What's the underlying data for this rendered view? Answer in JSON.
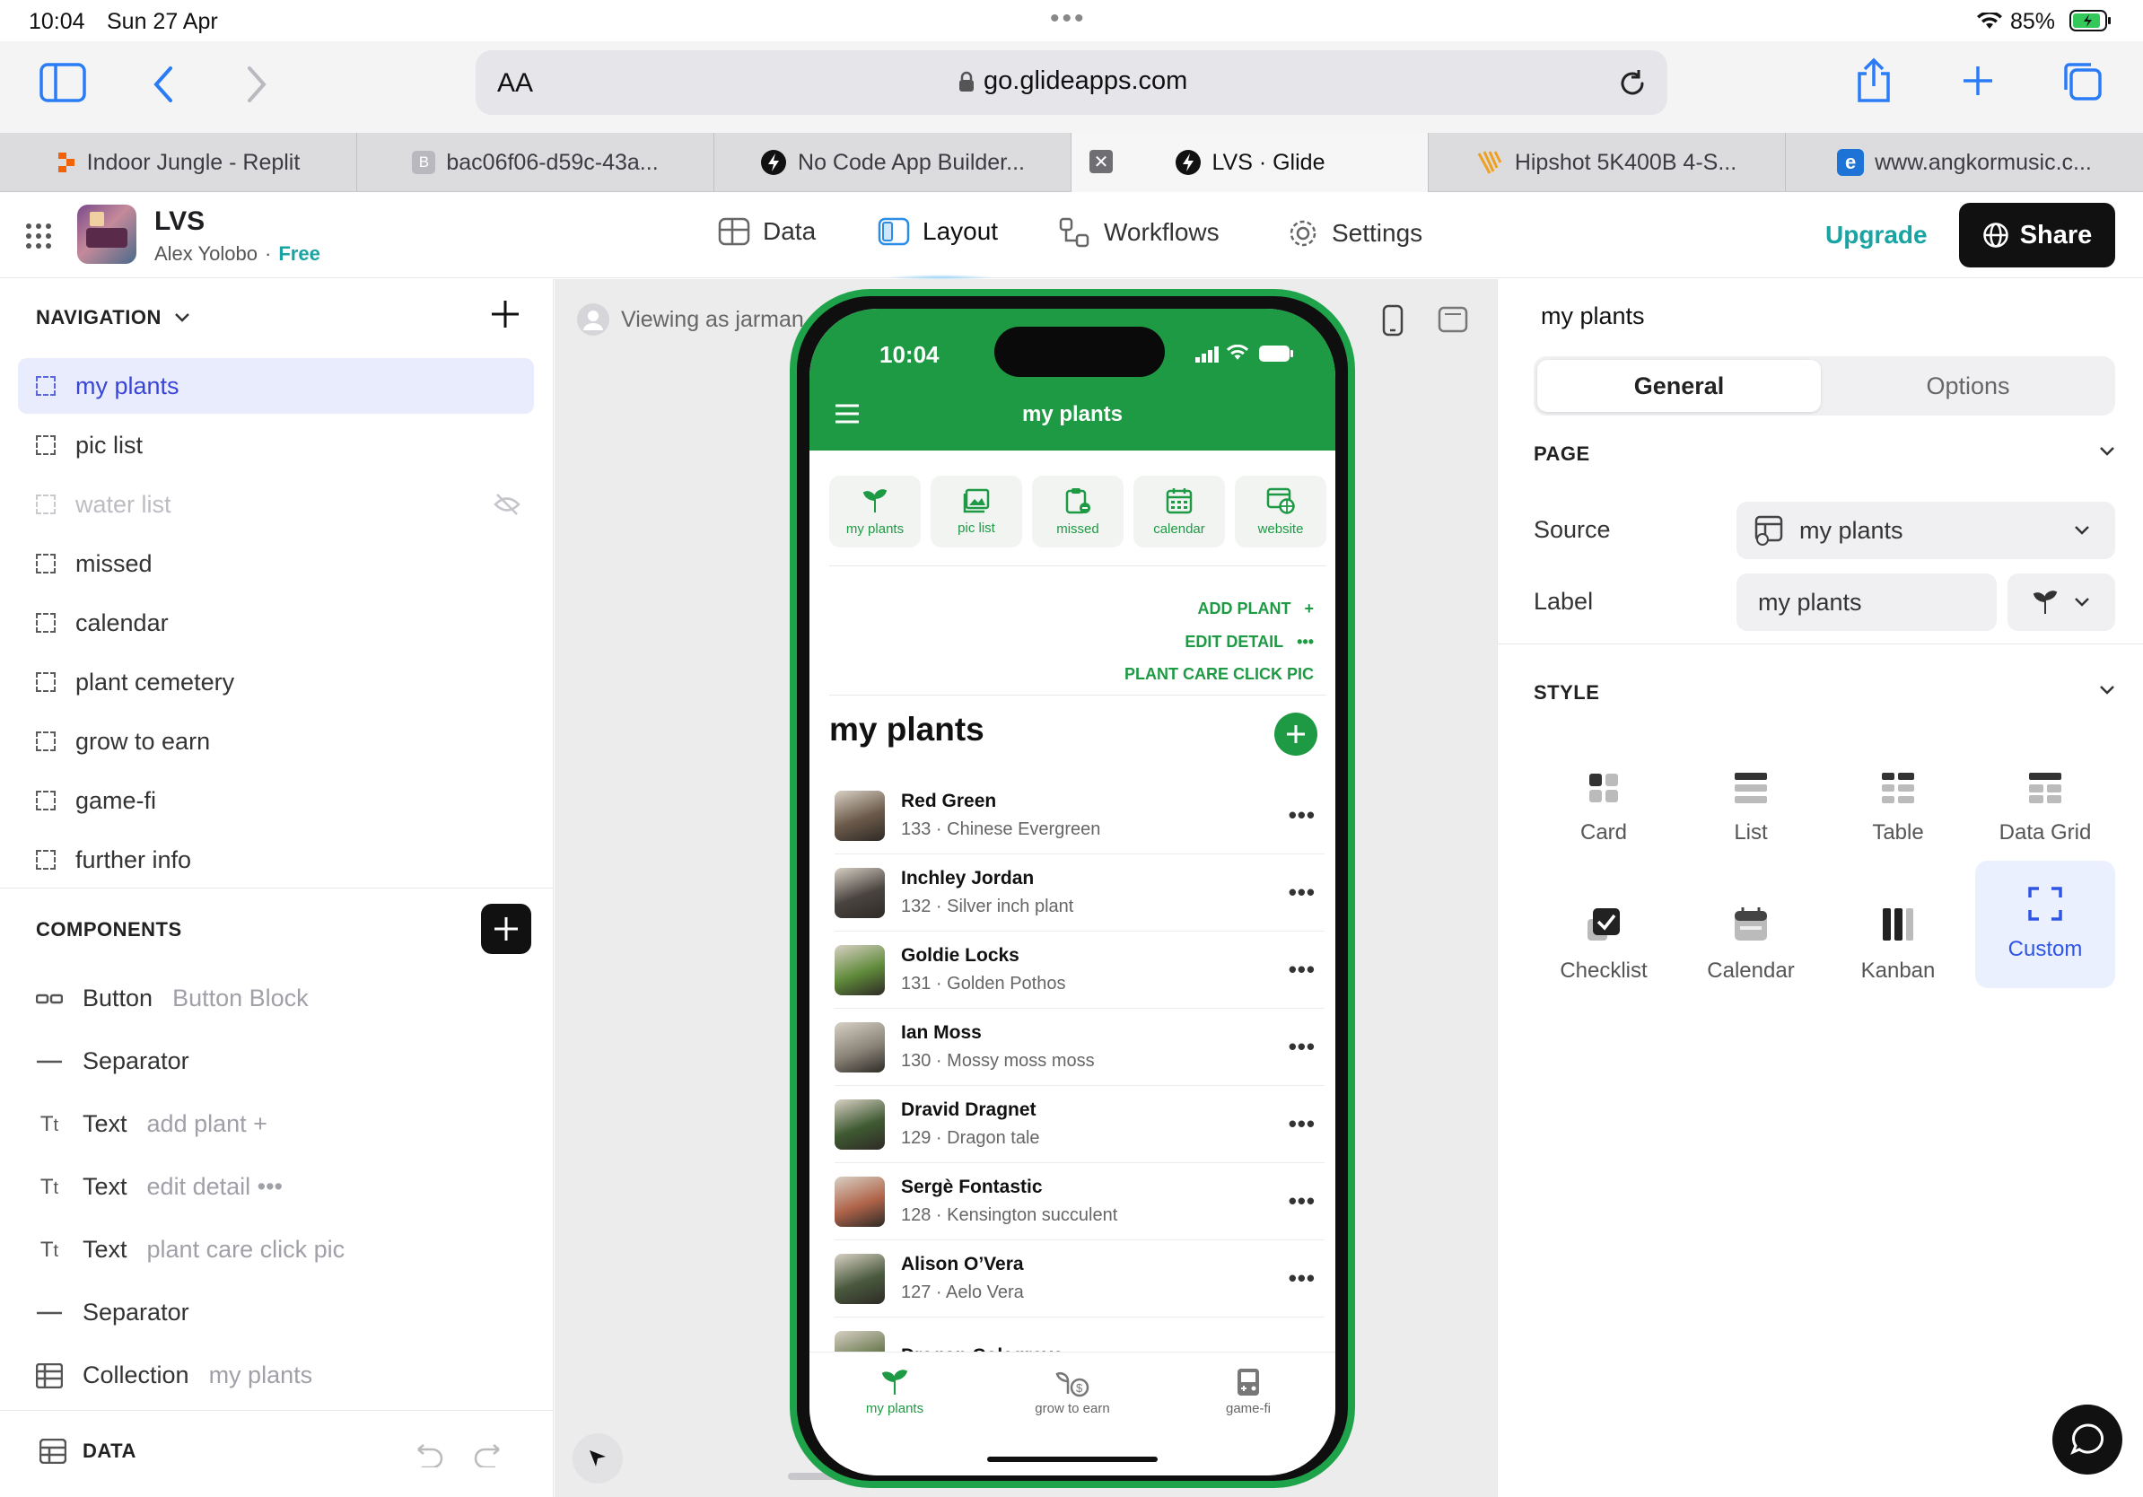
{
  "status_bar": {
    "time": "10:04",
    "date": "Sun 27 Apr",
    "battery": "85%"
  },
  "safari": {
    "text_size": "AA",
    "url": "go.glideapps.com"
  },
  "tabs": [
    {
      "label": "Indoor Jungle - Replit"
    },
    {
      "label": "bac06f06-d59c-43a..."
    },
    {
      "label": "No Code App Builder..."
    },
    {
      "label": "LVS · Glide",
      "active": true
    },
    {
      "label": "Hipshot 5K400B 4-S..."
    },
    {
      "label": "www.angkormusic.c..."
    }
  ],
  "app": {
    "name": "LVS",
    "owner": "Alex Yolobo",
    "separator": "·",
    "plan": "Free",
    "nav": [
      {
        "label": "Data"
      },
      {
        "label": "Layout",
        "active": true
      },
      {
        "label": "Workflows"
      },
      {
        "label": "Settings"
      }
    ],
    "upgrade": "Upgrade",
    "share": "Share"
  },
  "left": {
    "navigation_title": "NAVIGATION",
    "screens": [
      {
        "label": "my plants",
        "selected": true
      },
      {
        "label": "pic list"
      },
      {
        "label": "water list",
        "hidden": true
      },
      {
        "label": "missed"
      },
      {
        "label": "calendar"
      },
      {
        "label": "plant cemetery"
      },
      {
        "label": "grow to earn"
      },
      {
        "label": "game-fi"
      },
      {
        "label": "further info"
      }
    ],
    "components_title": "COMPONENTS",
    "components": [
      {
        "icon": "button-icon",
        "type": "Button",
        "value": "Button Block"
      },
      {
        "icon": "separator-icon",
        "type": "Separator",
        "value": ""
      },
      {
        "icon": "text-icon",
        "type": "Text",
        "value": "add plant +"
      },
      {
        "icon": "text-icon",
        "type": "Text",
        "value": "edit detail •••"
      },
      {
        "icon": "text-icon",
        "type": "Text",
        "value": "plant care click pic"
      },
      {
        "icon": "separator-icon",
        "type": "Separator",
        "value": ""
      },
      {
        "icon": "collection-icon",
        "type": "Collection",
        "value": "my plants"
      }
    ],
    "data_title": "DATA"
  },
  "canvas": {
    "viewing_as": "Viewing as jarman"
  },
  "phone": {
    "time": "10:04",
    "title": "my plants",
    "tiles": [
      "my plants",
      "pic list",
      "missed",
      "calendar",
      "website"
    ],
    "actions": [
      "ADD PLANT",
      "EDIT DETAIL",
      "PLANT CARE CLICK PIC"
    ],
    "action_suffix": [
      "+",
      "•••",
      ""
    ],
    "list_title": "my plants",
    "plants": [
      {
        "name": "Red Green",
        "id": "133",
        "species": "Chinese Evergreen",
        "color": "#6b5a4a"
      },
      {
        "name": "Inchley Jordan",
        "id": "132",
        "species": "Silver inch plant",
        "color": "#4a4440"
      },
      {
        "name": "Goldie Locks",
        "id": "131",
        "species": "Golden Pothos",
        "color": "#5f8a3a"
      },
      {
        "name": "Ian Moss",
        "id": "130",
        "species": "Mossy moss moss",
        "color": "#8a8478"
      },
      {
        "name": "Dravid Dragnet",
        "id": "129",
        "species": "Dragon tale",
        "color": "#3f5a32"
      },
      {
        "name": "Sergè Fontastic",
        "id": "128",
        "species": "Kensington succulent",
        "color": "#b0644a"
      },
      {
        "name": "Alison O’Vera",
        "id": "127",
        "species": "Aelo Vera",
        "color": "#4a5a3e"
      },
      {
        "name": "Dragon Colegrave",
        "id": "",
        "species": "",
        "color": "#6a7a50"
      }
    ],
    "tabbar": [
      "my plants",
      "grow to earn",
      "game-fi"
    ]
  },
  "right": {
    "title": "my plants",
    "tabs": [
      "General",
      "Options"
    ],
    "page_section": "PAGE",
    "source_label": "Source",
    "source_value": "my plants",
    "label_label": "Label",
    "label_value": "my plants",
    "style_section": "STYLE",
    "styles": [
      {
        "label": "Card"
      },
      {
        "label": "List"
      },
      {
        "label": "Table"
      },
      {
        "label": "Data Grid"
      },
      {
        "label": "Checklist"
      },
      {
        "label": "Calendar"
      },
      {
        "label": "Kanban"
      },
      {
        "label": "Custom",
        "selected": true
      }
    ]
  },
  "colors": {
    "accent_green": "#1e9a44",
    "brand_blue": "#3a45d6",
    "upgrade_teal": "#1aa3a3"
  }
}
